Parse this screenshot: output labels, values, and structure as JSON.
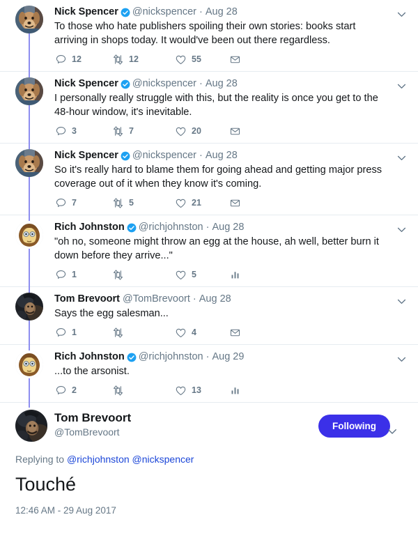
{
  "colors": {
    "accent_blue": "#1da1f2",
    "verified_blue": "#1da1f2",
    "follow_button_bg": "#3b30e8",
    "link_blue": "#1b46d8",
    "thread_connector": "#8e8ef0",
    "meta_gray": "#657786",
    "text_dark": "#14171a",
    "divider": "#e6ecf0"
  },
  "icons": {
    "reply": "speech-bubble-icon",
    "retweet": "retweet-icon",
    "like": "heart-icon",
    "message": "envelope-icon",
    "analytics": "analytics-bars-icon",
    "caret": "chevron-down-icon",
    "verified": "verified-badge-icon"
  },
  "tweets": [
    {
      "display_name": "Nick Spencer",
      "verified": true,
      "handle": "@nickspencer",
      "date": "Aug 28",
      "text": "To those who hate publishers spoiling their own stories: books start arriving in shops today. It would've been out there regardless.",
      "avatar": "dog-photo-avatar",
      "reply_count": "12",
      "retweet_count": "12",
      "like_count": "55",
      "last_action": "message"
    },
    {
      "display_name": "Nick Spencer",
      "verified": true,
      "handle": "@nickspencer",
      "date": "Aug 28",
      "text": "I personally really struggle with this, but the reality is once you get to the 48-hour window, it's inevitable.",
      "avatar": "dog-photo-avatar",
      "reply_count": "3",
      "retweet_count": "7",
      "like_count": "20",
      "last_action": "message"
    },
    {
      "display_name": "Nick Spencer",
      "verified": true,
      "handle": "@nickspencer",
      "date": "Aug 28",
      "text": "So it's really hard to blame them for going ahead and getting major press coverage out of it when they know it's coming.",
      "avatar": "dog-photo-avatar",
      "reply_count": "7",
      "retweet_count": "5",
      "like_count": "21",
      "last_action": "message"
    },
    {
      "display_name": "Rich Johnston",
      "verified": true,
      "handle": "@richjohnston",
      "date": "Aug 28",
      "text": "\"oh no, someone might throw an egg at the house, ah well, better burn it down before they arrive...\"",
      "avatar": "cartoon-face-avatar",
      "reply_count": "1",
      "retweet_count": "",
      "like_count": "5",
      "last_action": "analytics"
    },
    {
      "display_name": "Tom Brevoort",
      "verified": false,
      "handle": "@TomBrevoort",
      "date": "Aug 28",
      "text": "Says the egg salesman...",
      "avatar": "dark-photo-avatar",
      "reply_count": "1",
      "retweet_count": "",
      "like_count": "4",
      "last_action": "message"
    },
    {
      "display_name": "Rich Johnston",
      "verified": true,
      "handle": "@richjohnston",
      "date": "Aug 29",
      "text": "...to the arsonist.",
      "avatar": "cartoon-face-avatar",
      "reply_count": "2",
      "retweet_count": "",
      "like_count": "13",
      "last_action": "analytics"
    }
  ],
  "main_tweet": {
    "display_name": "Tom Brevoort",
    "handle": "@TomBrevoort",
    "avatar": "dark-photo-avatar",
    "follow_label": "Following",
    "replying_prefix": "Replying to ",
    "replying_to": [
      "@richjohnston",
      "@nickspencer"
    ],
    "text": "Touché",
    "timestamp": "12:46 AM - 29 Aug 2017"
  }
}
